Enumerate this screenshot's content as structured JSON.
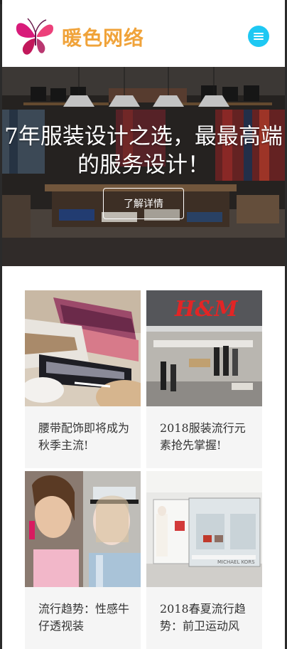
{
  "header": {
    "brand": "暖色网络",
    "logo_icon": "butterfly-logo-icon",
    "menu_icon": "hamburger-menu-icon",
    "accent": "#1ec8f3",
    "brand_color": "#f0a33a"
  },
  "hero": {
    "title": "7年服装设计之选，最最高端的服务设计！",
    "button_label": "了解详情"
  },
  "articles": [
    {
      "title": "腰带配饰即将成为秋季主流!",
      "image": "fabric-shoes-photo"
    },
    {
      "title": "2018服装流行元素抢先掌握!",
      "image": "hm-store-photo"
    },
    {
      "title": "流行趋势：性感牛仔透视装",
      "image": "fashion-models-photo"
    },
    {
      "title": "2018春夏流行趋势：前卫运动风",
      "image": "boutique-store-photo"
    }
  ]
}
